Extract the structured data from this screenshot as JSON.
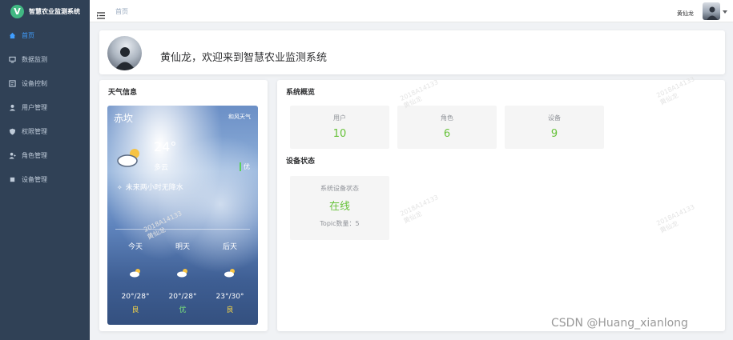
{
  "app": {
    "title": "智慧农业监测系统",
    "logo_letter": "V"
  },
  "sidebar": {
    "items": [
      {
        "label": "首页",
        "icon": "home-icon",
        "active": true
      },
      {
        "label": "数据监测",
        "icon": "monitor-icon",
        "active": false
      },
      {
        "label": "设备控制",
        "icon": "device-control-icon",
        "active": false
      },
      {
        "label": "用户管理",
        "icon": "user-icon",
        "active": false
      },
      {
        "label": "权限管理",
        "icon": "shield-icon",
        "active": false
      },
      {
        "label": "角色管理",
        "icon": "role-icon",
        "active": false
      },
      {
        "label": "设备管理",
        "icon": "device-icon",
        "active": false
      }
    ]
  },
  "header": {
    "breadcrumb": "首页",
    "user_name": "黄仙龙"
  },
  "welcome": {
    "text": "黄仙龙，欢迎来到智慧农业监测系统"
  },
  "weather_card": {
    "title": "天气信息",
    "city": "赤坎",
    "brand": "和风天气",
    "temperature": "24°",
    "condition": "多云",
    "aqi": "优",
    "note": "未来两小时无降水",
    "forecast": [
      {
        "day": "今天",
        "range": "20°/28°",
        "quality": "良"
      },
      {
        "day": "明天",
        "range": "20°/28°",
        "quality": "优"
      },
      {
        "day": "后天",
        "range": "23°/30°",
        "quality": "良"
      }
    ]
  },
  "overview": {
    "title": "系统概览",
    "stats": [
      {
        "label": "用户",
        "value": "10"
      },
      {
        "label": "角色",
        "value": "6"
      },
      {
        "label": "设备",
        "value": "9"
      }
    ],
    "device_status_title": "设备状态",
    "device": {
      "label": "系统设备状态",
      "status": "在线",
      "topic": "Topic数量：5"
    }
  },
  "watermark": {
    "line1": "2018A14133",
    "line2": "黄仙龙"
  },
  "footer_watermark": "CSDN @Huang_xianlong",
  "colors": {
    "sidebar": "#304156",
    "active": "#409eff",
    "value": "#67c23a",
    "background": "#f0f2f5"
  }
}
